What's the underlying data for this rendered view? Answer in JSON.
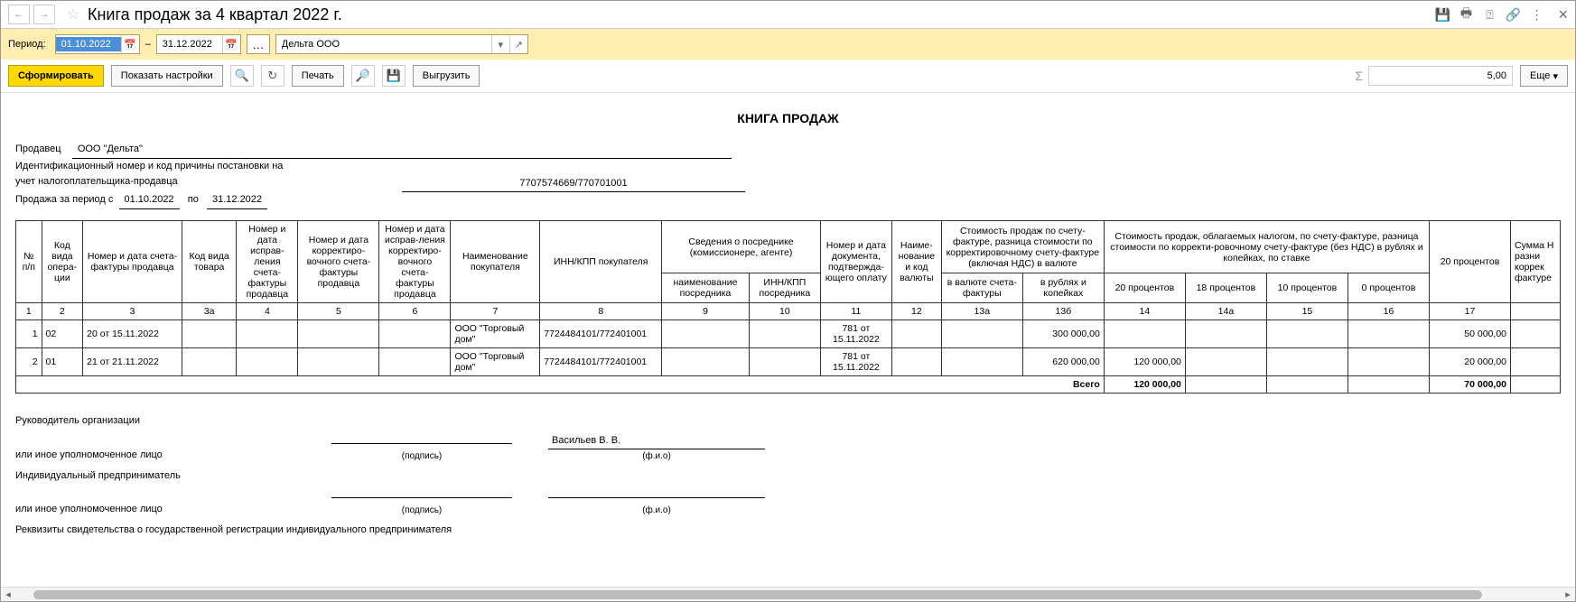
{
  "title": "Книга продаж за 4 квартал 2022 г.",
  "period": {
    "label": "Период:",
    "from": "01.10.2022",
    "dash": "–",
    "to": "31.12.2022"
  },
  "org_name": "Дельта ООО",
  "toolbar": {
    "form": "Сформировать",
    "show_settings": "Показать настройки",
    "print": "Печать",
    "export": "Выгрузить",
    "more": "Еще"
  },
  "sum_value": "5,00",
  "report": {
    "heading": "КНИГА ПРОДАЖ",
    "seller_label": "Продавец",
    "seller_name": "ООО \"Дельта\"",
    "inn_label": "Идентификационный номер и код причины постановки на учет налогоплательщика-продавца",
    "inn_value": "7707574669/770701001",
    "sale_period_prefix": "Продажа за период с",
    "sale_period_mid": "по",
    "sale_from": "01.10.2022",
    "sale_to": "31.12.2022"
  },
  "columns": {
    "c1": "№ п/п",
    "c2": "Код вида опера-ции",
    "c3": "Номер и дата счета-фактуры продавца",
    "c3a": "Код вида товара",
    "c4": "Номер и дата исправ-ления счета-фактуры продавца",
    "c5": "Номер и дата корректиро-вочного счета-фактуры продавца",
    "c6": "Номер и дата исправ-ления корректиро-вочного счета-фактуры продавца",
    "c7": "Наименование покупателя",
    "c8": "ИНН/КПП покупателя",
    "c9g": "Сведения о посреднике (комиссионере, агенте)",
    "c9": "наименование посредника",
    "c10": "ИНН/КПП посредника",
    "c11": "Номер и дата документа, подтвержда-ющего оплату",
    "c12": "Наиме-нование и код валюты",
    "c13g": "Стоимость продаж по счету-фактуре, разница стоимости по корректировочному счету-фактуре (включая НДС) в валюте",
    "c13a": "в валюте счета-фактуры",
    "c13b": "в рублях и копейках",
    "c14g": "Стоимость продаж, облагаемых налогом, по счету-фактуре, разница стоимости по корректи-ровочному счету-фактуре (без НДС) в рублях и копейках, по ставке",
    "c14": "20 процентов",
    "c14a": "18 процентов",
    "c15": "10 процентов",
    "c16": "0 процентов",
    "c17": "20 процентов",
    "c18g": "Сумма Н разни коррек фактуре"
  },
  "colnums": {
    "n1": "1",
    "n2": "2",
    "n3": "3",
    "n3a": "3а",
    "n4": "4",
    "n5": "5",
    "n6": "6",
    "n7": "7",
    "n8": "8",
    "n9": "9",
    "n10": "10",
    "n11": "11",
    "n12": "12",
    "n13a": "13а",
    "n13b": "13б",
    "n14": "14",
    "n14a": "14а",
    "n15": "15",
    "n16": "16",
    "n17": "17"
  },
  "rows": [
    {
      "n": "1",
      "op": "02",
      "sf": "20 от 15.11.2022",
      "buyer": "ООО \"Торговый дом\"",
      "innkpp": "7724484101/772401001",
      "pay": "781 от 15.11.2022",
      "rub": "300 000,00",
      "p20a": "",
      "p17": "50 000,00"
    },
    {
      "n": "2",
      "op": "01",
      "sf": "21 от 21.11.2022",
      "buyer": "ООО \"Торговый дом\"",
      "innkpp": "7724484101/772401001",
      "pay": "781 от 15.11.2022",
      "rub": "620 000,00",
      "p20a": "120 000,00",
      "p17": "20 000,00"
    }
  ],
  "totals": {
    "label": "Всего",
    "p20a": "120 000,00",
    "p17": "70 000,00"
  },
  "signatures": {
    "head1": "Руководитель организации",
    "head2": "или иное уполномоченное лицо",
    "sub_sign": "(подпись)",
    "sub_fio": "(ф.и.о)",
    "fio": "Васильев В. В.",
    "ip1": "Индивидуальный предприниматель",
    "ip2": "или иное уполномоченное лицо",
    "cert": "Реквизиты свидетельства о государственной регистрации индивидуального предпринимателя"
  }
}
